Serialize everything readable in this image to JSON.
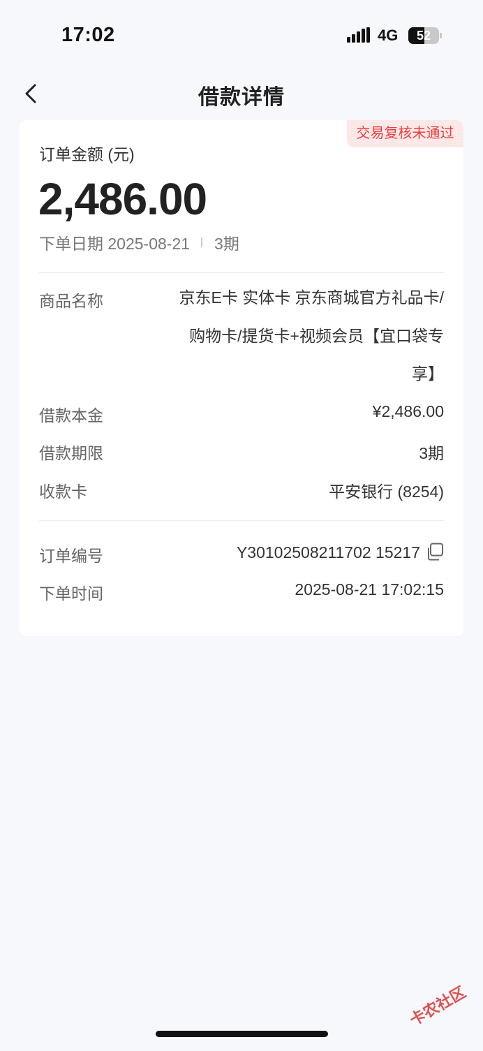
{
  "status_bar": {
    "time": "17:02",
    "network": "4G",
    "battery": "52",
    "battery_level": 0.52
  },
  "nav": {
    "title": "借款详情",
    "back_icon": "chevron-left-icon"
  },
  "order": {
    "status_badge": "交易复核未通过",
    "amount_label": "订单金额 (元)",
    "amount": "2,486.00",
    "date_label": "下单日期 2025-08-21",
    "periods": "3期"
  },
  "details": [
    {
      "label": "借款本金",
      "value": "¥2,486.00"
    },
    {
      "label": "借款期限",
      "value": "3期"
    },
    {
      "label": "收款卡",
      "value": "平安银行 (8254)"
    }
  ],
  "product": {
    "label": "商品名称",
    "value": "京东E卡 实体卡 京东商城官方礼品卡/购物卡/提货卡+视频会员【宜口袋专享】"
  },
  "order_info": {
    "number_label": "订单编号",
    "number": "Y30102508211702 15217",
    "time_label": "下单时间",
    "time": "2025-08-21 17:02:15"
  },
  "watermark": "卡农社区",
  "colors": {
    "badge_text": "#e84040",
    "badge_bg": "#fde8e8",
    "page_bg": "#f7f8fc"
  }
}
